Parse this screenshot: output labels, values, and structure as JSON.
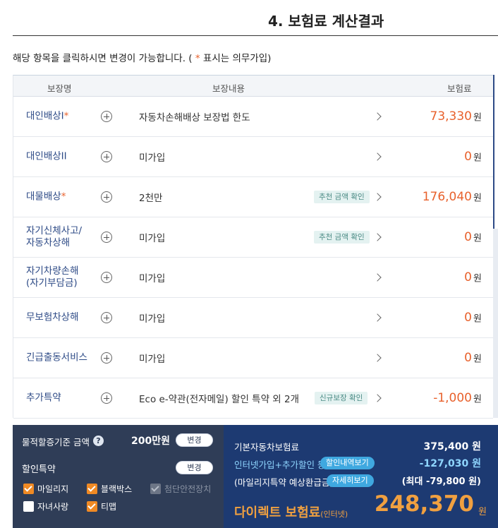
{
  "title": "4. 보험료 계산결과",
  "notice": {
    "before": "해당 항목을 클릭하시면 변경이 가능합니다. ( ",
    "star": "*",
    "after": " 표시는 의무가입)"
  },
  "table": {
    "headers": {
      "name": "보장명",
      "desc": "보장내용",
      "price": "보험료"
    },
    "rows": [
      {
        "name": "대인배상I",
        "required": "*",
        "desc": "자동차손해배상 보장법 한도",
        "tag": "",
        "price": "73,330",
        "unit": "원"
      },
      {
        "name": "대인배상II",
        "required": "",
        "desc": "미가입",
        "tag": "",
        "price": "0",
        "unit": "원"
      },
      {
        "name": "대물배상",
        "required": "*",
        "desc": "2천만",
        "tag": "추천 금액 확인",
        "price": "176,040",
        "unit": "원"
      },
      {
        "name": "자기신체사고/\n자동차상해",
        "required": "",
        "desc": "미가입",
        "tag": "추천 금액 확인",
        "price": "0",
        "unit": "원"
      },
      {
        "name": "자기차량손해\n(자기부담금)",
        "required": "",
        "desc": "미가입",
        "tag": "",
        "price": "0",
        "unit": "원"
      },
      {
        "name": "무보험차상해",
        "required": "",
        "desc": "미가입",
        "tag": "",
        "price": "0",
        "unit": "원"
      },
      {
        "name": "긴급출동서비스",
        "required": "",
        "desc": "미가입",
        "tag": "",
        "price": "0",
        "unit": "원"
      },
      {
        "name": "추가특약",
        "required": "",
        "desc": "Eco e-약관(전자메일) 할인 특약 외 2개",
        "tag": "신규보장 확인",
        "price": "-1,000",
        "unit": "원"
      }
    ]
  },
  "left_panel": {
    "property_label": "물적할증기준 금액",
    "help_icon": "?",
    "property_value": "200만원",
    "change_label": "변경",
    "discount_label": "할인특약",
    "discount_change_label": "변경",
    "options": [
      {
        "label": "마일리지",
        "state": "on"
      },
      {
        "label": "블랙박스",
        "state": "on"
      },
      {
        "label": "첨단안전장치",
        "state": "disabled"
      },
      {
        "label": "자녀사랑",
        "state": "off"
      },
      {
        "label": "티맵",
        "state": "on"
      }
    ]
  },
  "right_panel": {
    "base_label": "기본자동차보험료",
    "base_value": "375,400 원",
    "discount_label": "인터넷가입+추가할인 등",
    "discount_pill": "할인내역보기",
    "discount_value": "-127,030 원",
    "mileage_label": "(마일리지특약 예상환급금)",
    "mileage_pill": "자세히보기",
    "mileage_value": "(최대 -79,800 원)",
    "direct_label": "다이렉트 보험료",
    "direct_sub": "(인터넷)",
    "direct_amount": "248,370",
    "direct_unit": "원"
  },
  "colors": {
    "accent": "#e8612c",
    "navy": "#1d3a72",
    "panel": "#2f3d57",
    "orange": "#f0a040",
    "cyan": "#8fd6ff"
  }
}
